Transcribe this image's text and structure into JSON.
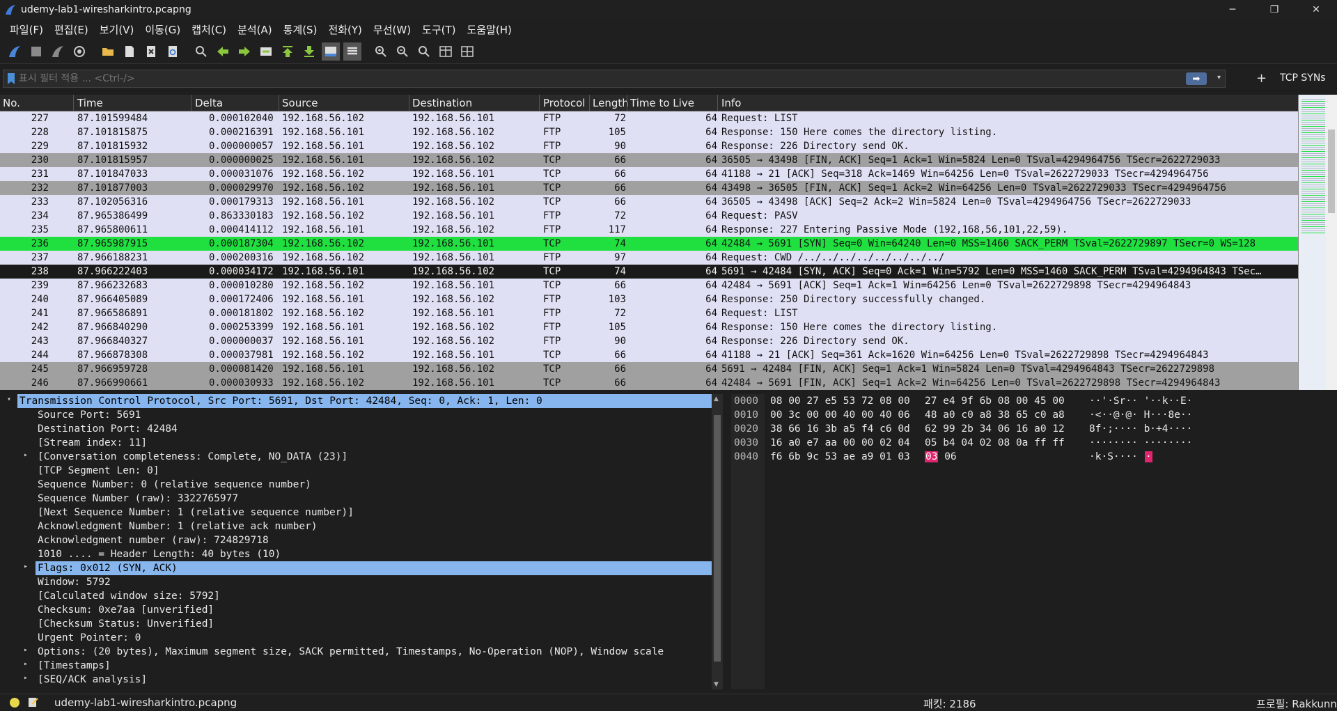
{
  "window": {
    "title": "udemy-lab1-wiresharkintro.pcapng",
    "minimize_glyph": "─",
    "maximize_glyph": "❐",
    "close_glyph": "✕"
  },
  "menu": [
    "파일(F)",
    "편집(E)",
    "보기(V)",
    "이동(G)",
    "캡처(C)",
    "분석(A)",
    "통계(S)",
    "전화(Y)",
    "무선(W)",
    "도구(T)",
    "도움말(H)"
  ],
  "toolbar_icons": [
    "shark-fin-start-icon",
    "stop-icon",
    "restart-icon",
    "capture-options-icon",
    "open-folder-icon",
    "save-file-icon",
    "close-file-icon",
    "reload-icon",
    "find-packet-icon",
    "go-back-icon",
    "go-forward-icon",
    "go-to-packet-icon",
    "go-first-icon",
    "go-last-icon",
    "auto-scroll-icon",
    "colorize-icon",
    "zoom-in-icon",
    "zoom-out-icon",
    "zoom-reset-icon",
    "resize-columns-icon",
    "layout-icon"
  ],
  "filter": {
    "placeholder": "표시 필터 적용 ... <Ctrl-/>",
    "apply_glyph": "➡",
    "dropdown_glyph": "▾",
    "plus_glyph": "+",
    "button_label": "TCP SYNs"
  },
  "columns": [
    "No.",
    "Time",
    "Delta",
    "Source",
    "Destination",
    "Protocol",
    "Length",
    "Time to Live",
    "Info"
  ],
  "packets": [
    {
      "no": "227",
      "time": "87.101599484",
      "delta": "0.000102040",
      "src": "192.168.56.102",
      "dst": "192.168.56.101",
      "proto": "FTP",
      "len": "72",
      "ttl": "64",
      "info": "Request: LIST",
      "style": "light"
    },
    {
      "no": "228",
      "time": "87.101815875",
      "delta": "0.000216391",
      "src": "192.168.56.101",
      "dst": "192.168.56.102",
      "proto": "FTP",
      "len": "105",
      "ttl": "64",
      "info": "Response: 150 Here comes the directory listing.",
      "style": "light"
    },
    {
      "no": "229",
      "time": "87.101815932",
      "delta": "0.000000057",
      "src": "192.168.56.101",
      "dst": "192.168.56.102",
      "proto": "FTP",
      "len": "90",
      "ttl": "64",
      "info": "Response: 226 Directory send OK.",
      "style": "light"
    },
    {
      "no": "230",
      "time": "87.101815957",
      "delta": "0.000000025",
      "src": "192.168.56.101",
      "dst": "192.168.56.102",
      "proto": "TCP",
      "len": "66",
      "ttl": "64",
      "info": "36505 → 43498 [FIN, ACK] Seq=1 Ack=1 Win=5824 Len=0 TSval=4294964756 TSecr=2622729033",
      "style": "gray"
    },
    {
      "no": "231",
      "time": "87.101847033",
      "delta": "0.000031076",
      "src": "192.168.56.102",
      "dst": "192.168.56.101",
      "proto": "TCP",
      "len": "66",
      "ttl": "64",
      "info": "41188 → 21 [ACK] Seq=318 Ack=1469 Win=64256 Len=0 TSval=2622729033 TSecr=4294964756",
      "style": "light"
    },
    {
      "no": "232",
      "time": "87.101877003",
      "delta": "0.000029970",
      "src": "192.168.56.102",
      "dst": "192.168.56.101",
      "proto": "TCP",
      "len": "66",
      "ttl": "64",
      "info": "43498 → 36505 [FIN, ACK] Seq=1 Ack=2 Win=64256 Len=0 TSval=2622729033 TSecr=4294964756",
      "style": "gray"
    },
    {
      "no": "233",
      "time": "87.102056316",
      "delta": "0.000179313",
      "src": "192.168.56.101",
      "dst": "192.168.56.102",
      "proto": "TCP",
      "len": "66",
      "ttl": "64",
      "info": "36505 → 43498 [ACK] Seq=2 Ack=2 Win=5824 Len=0 TSval=4294964756 TSecr=2622729033",
      "style": "light"
    },
    {
      "no": "234",
      "time": "87.965386499",
      "delta": "0.863330183",
      "src": "192.168.56.102",
      "dst": "192.168.56.101",
      "proto": "FTP",
      "len": "72",
      "ttl": "64",
      "info": "Request: PASV",
      "style": "light"
    },
    {
      "no": "235",
      "time": "87.965800611",
      "delta": "0.000414112",
      "src": "192.168.56.101",
      "dst": "192.168.56.102",
      "proto": "FTP",
      "len": "117",
      "ttl": "64",
      "info": "Response: 227 Entering Passive Mode (192,168,56,101,22,59).",
      "style": "light"
    },
    {
      "no": "236",
      "time": "87.965987915",
      "delta": "0.000187304",
      "src": "192.168.56.102",
      "dst": "192.168.56.101",
      "proto": "TCP",
      "len": "74",
      "ttl": "64",
      "info": "42484 → 5691 [SYN] Seq=0 Win=64240 Len=0 MSS=1460 SACK_PERM TSval=2622729897 TSecr=0 WS=128",
      "style": "green"
    },
    {
      "no": "237",
      "time": "87.966188231",
      "delta": "0.000200316",
      "src": "192.168.56.102",
      "dst": "192.168.56.101",
      "proto": "FTP",
      "len": "97",
      "ttl": "64",
      "info": "Request: CWD /../../../../../../../../",
      "style": "light"
    },
    {
      "no": "238",
      "time": "87.966222403",
      "delta": "0.000034172",
      "src": "192.168.56.101",
      "dst": "192.168.56.102",
      "proto": "TCP",
      "len": "74",
      "ttl": "64",
      "info": "5691 → 42484 [SYN, ACK] Seq=0 Ack=1 Win=5792 Len=0 MSS=1460 SACK_PERM TSval=4294964843 TSec…",
      "style": "sel"
    },
    {
      "no": "239",
      "time": "87.966232683",
      "delta": "0.000010280",
      "src": "192.168.56.102",
      "dst": "192.168.56.101",
      "proto": "TCP",
      "len": "66",
      "ttl": "64",
      "info": "42484 → 5691 [ACK] Seq=1 Ack=1 Win=64256 Len=0 TSval=2622729898 TSecr=4294964843",
      "style": "light"
    },
    {
      "no": "240",
      "time": "87.966405089",
      "delta": "0.000172406",
      "src": "192.168.56.101",
      "dst": "192.168.56.102",
      "proto": "FTP",
      "len": "103",
      "ttl": "64",
      "info": "Response: 250 Directory successfully changed.",
      "style": "light"
    },
    {
      "no": "241",
      "time": "87.966586891",
      "delta": "0.000181802",
      "src": "192.168.56.102",
      "dst": "192.168.56.101",
      "proto": "FTP",
      "len": "72",
      "ttl": "64",
      "info": "Request: LIST",
      "style": "light"
    },
    {
      "no": "242",
      "time": "87.966840290",
      "delta": "0.000253399",
      "src": "192.168.56.101",
      "dst": "192.168.56.102",
      "proto": "FTP",
      "len": "105",
      "ttl": "64",
      "info": "Response: 150 Here comes the directory listing.",
      "style": "light"
    },
    {
      "no": "243",
      "time": "87.966840327",
      "delta": "0.000000037",
      "src": "192.168.56.101",
      "dst": "192.168.56.102",
      "proto": "FTP",
      "len": "90",
      "ttl": "64",
      "info": "Response: 226 Directory send OK.",
      "style": "light"
    },
    {
      "no": "244",
      "time": "87.966878308",
      "delta": "0.000037981",
      "src": "192.168.56.102",
      "dst": "192.168.56.101",
      "proto": "TCP",
      "len": "66",
      "ttl": "64",
      "info": "41188 → 21 [ACK] Seq=361 Ack=1620 Win=64256 Len=0 TSval=2622729898 TSecr=4294964843",
      "style": "light"
    },
    {
      "no": "245",
      "time": "87.966959728",
      "delta": "0.000081420",
      "src": "192.168.56.101",
      "dst": "192.168.56.102",
      "proto": "TCP",
      "len": "66",
      "ttl": "64",
      "info": "5691 → 42484 [FIN, ACK] Seq=1 Ack=1 Win=5824 Len=0 TSval=4294964843 TSecr=2622729898",
      "style": "gray"
    },
    {
      "no": "246",
      "time": "87.966990661",
      "delta": "0.000030933",
      "src": "192.168.56.102",
      "dst": "192.168.56.101",
      "proto": "TCP",
      "len": "66",
      "ttl": "64",
      "info": "42484 → 5691 [FIN, ACK] Seq=1 Ack=2 Win=64256 Len=0 TSval=2622729898 TSecr=4294964843",
      "style": "gray"
    }
  ],
  "details": [
    {
      "indent": 0,
      "twisty": "▾",
      "text": "Transmission Control Protocol, Src Port: 5691, Dst Port: 42484, Seq: 0, Ack: 1, Len: 0",
      "hl": true
    },
    {
      "indent": 1,
      "twisty": "",
      "text": "Source Port: 5691",
      "hl": false
    },
    {
      "indent": 1,
      "twisty": "",
      "text": "Destination Port: 42484",
      "hl": false
    },
    {
      "indent": 1,
      "twisty": "",
      "text": "[Stream index: 11]",
      "hl": false
    },
    {
      "indent": 1,
      "twisty": "▸",
      "text": "[Conversation completeness: Complete, NO_DATA (23)]",
      "hl": false
    },
    {
      "indent": 1,
      "twisty": "",
      "text": "[TCP Segment Len: 0]",
      "hl": false
    },
    {
      "indent": 1,
      "twisty": "",
      "text": "Sequence Number: 0    (relative sequence number)",
      "hl": false
    },
    {
      "indent": 1,
      "twisty": "",
      "text": "Sequence Number (raw): 3322765977",
      "hl": false
    },
    {
      "indent": 1,
      "twisty": "",
      "text": "[Next Sequence Number: 1    (relative sequence number)]",
      "hl": false
    },
    {
      "indent": 1,
      "twisty": "",
      "text": "Acknowledgment Number: 1    (relative ack number)",
      "hl": false
    },
    {
      "indent": 1,
      "twisty": "",
      "text": "Acknowledgment number (raw): 724829718",
      "hl": false
    },
    {
      "indent": 1,
      "twisty": "",
      "text": "1010 .... = Header Length: 40 bytes (10)",
      "hl": false
    },
    {
      "indent": 1,
      "twisty": "▸",
      "text": "Flags: 0x012 (SYN, ACK)",
      "hl": true
    },
    {
      "indent": 1,
      "twisty": "",
      "text": "Window: 5792",
      "hl": false
    },
    {
      "indent": 1,
      "twisty": "",
      "text": "[Calculated window size: 5792]",
      "hl": false
    },
    {
      "indent": 1,
      "twisty": "",
      "text": "Checksum: 0xe7aa [unverified]",
      "hl": false
    },
    {
      "indent": 1,
      "twisty": "",
      "text": "[Checksum Status: Unverified]",
      "hl": false
    },
    {
      "indent": 1,
      "twisty": "",
      "text": "Urgent Pointer: 0",
      "hl": false
    },
    {
      "indent": 1,
      "twisty": "▸",
      "text": "Options: (20 bytes), Maximum segment size, SACK permitted, Timestamps, No-Operation (NOP), Window scale",
      "hl": false
    },
    {
      "indent": 1,
      "twisty": "▸",
      "text": "[Timestamps]",
      "hl": false
    },
    {
      "indent": 1,
      "twisty": "▸",
      "text": "[SEQ/ACK analysis]",
      "hl": false
    }
  ],
  "hex": [
    {
      "offset": "0000",
      "bytes_a": "08 00 27 e5 53 72 08 00",
      "bytes_b": "27 e4 9f 6b 08 00 45 00",
      "ascii": "··'·Sr·· '··k··E·"
    },
    {
      "offset": "0010",
      "bytes_a": "00 3c 00 00 40 00 40 06",
      "bytes_b": "48 a0 c0 a8 38 65 c0 a8",
      "ascii": "·<··@·@· H···8e··"
    },
    {
      "offset": "0020",
      "bytes_a": "38 66 16 3b a5 f4 c6 0d",
      "bytes_b": "62 99 2b 34 06 16 a0 12",
      "ascii": "8f·;···· b·+4····"
    },
    {
      "offset": "0030",
      "bytes_a": "16 a0 e7 aa 00 00 02 04",
      "bytes_b": "05 b4 04 02 08 0a ff ff",
      "ascii": "········ ········"
    },
    {
      "offset": "0040",
      "bytes_a": "f6 6b 9c 53 ae a9 01 03",
      "bytes_b": "03 06",
      "ascii": "·k·S····"
    }
  ],
  "hex_highlight": {
    "byte": "03",
    "rest": " 06",
    "ascii_hl": "·"
  },
  "status": {
    "file": "udemy-lab1-wiresharkintro.pcapng",
    "packets": "패킷: 2186",
    "profile": "프로필: Rakkunn"
  },
  "colors": {
    "row_light": "#dfe0f4",
    "row_gray": "#a0a0a0",
    "row_green": "#20e040",
    "row_selected": "#1a1a1a",
    "detail_highlight": "#87b6ee",
    "hex_highlight": "#e0246e"
  }
}
